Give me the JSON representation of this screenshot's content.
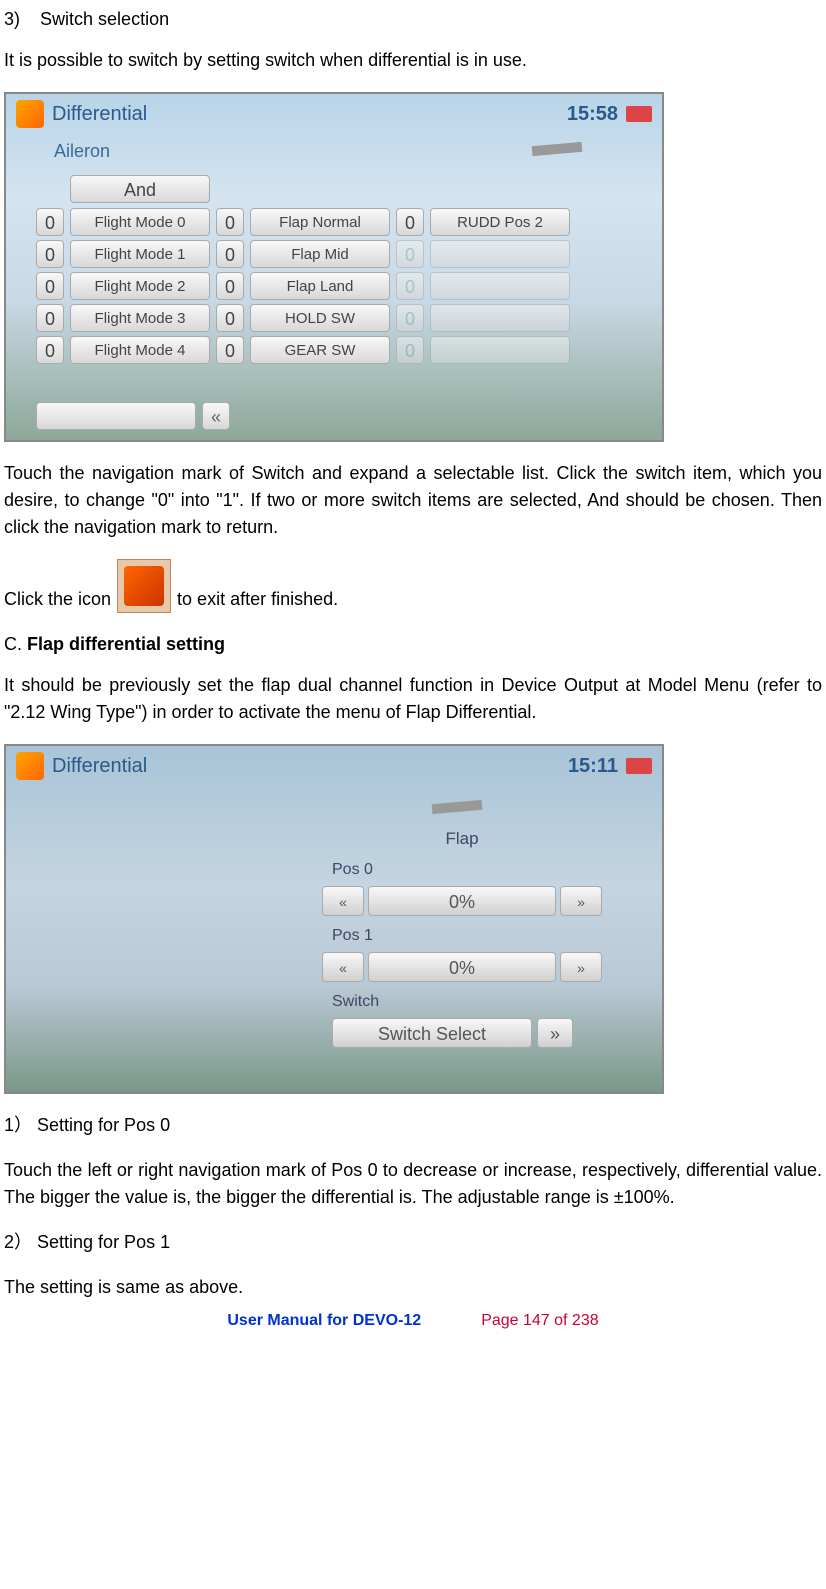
{
  "section3": {
    "num": "3)",
    "title": "Switch selection",
    "intro": "It is possible to switch by setting switch when differential is in use."
  },
  "screenshot1": {
    "title": "Differential",
    "subtitle": "Aileron",
    "clock": "15:58",
    "and_label": "And",
    "rows": [
      [
        {
          "n": "0",
          "l": "Flight Mode 0"
        },
        {
          "n": "0",
          "l": "Flap Normal"
        },
        {
          "n": "0",
          "l": "RUDD Pos 2"
        }
      ],
      [
        {
          "n": "0",
          "l": "Flight Mode 1"
        },
        {
          "n": "0",
          "l": "Flap Mid"
        },
        {
          "n": "0",
          "l": ""
        }
      ],
      [
        {
          "n": "0",
          "l": "Flight Mode 2"
        },
        {
          "n": "0",
          "l": "Flap Land"
        },
        {
          "n": "0",
          "l": ""
        }
      ],
      [
        {
          "n": "0",
          "l": "Flight Mode 3"
        },
        {
          "n": "0",
          "l": "HOLD SW"
        },
        {
          "n": "0",
          "l": ""
        }
      ],
      [
        {
          "n": "0",
          "l": "Flight Mode 4"
        },
        {
          "n": "0",
          "l": "GEAR SW"
        },
        {
          "n": "0",
          "l": ""
        }
      ]
    ],
    "arrow": "«"
  },
  "para_touch": "Touch the navigation mark of Switch and expand a selectable list. Click the switch item, which you desire, to change \"0\" into \"1\". If two or more switch items are selected, And should be chosen. Then click the navigation mark to return.",
  "click_icon_before": "Click the icon",
  "click_icon_after": "to exit after finished.",
  "sectionC": {
    "prefix": "C. ",
    "title": "Flap differential setting",
    "intro": "It should be previously set the flap dual channel function in Device Output at Model Menu (refer to \"2.12 Wing Type\") in order to activate the menu of Flap Differential."
  },
  "screenshot2": {
    "title": "Differential",
    "clock": "15:11",
    "flap_label": "Flap",
    "pos0_label": "Pos 0",
    "pos0_val": "0%",
    "pos1_label": "Pos 1",
    "pos1_val": "0%",
    "switch_label": "Switch",
    "switch_btn": "Switch Select",
    "arr_left": "«",
    "arr_right": "»"
  },
  "item1": "1） Setting for Pos 0",
  "para_pos0": "Touch the left or right navigation mark of Pos 0 to decrease or increase, respectively, differential value. The bigger the value is, the bigger the differential is. The adjustable range is ±100%.",
  "item2": "2） Setting for Pos 1",
  "para_pos1": "The setting is same as above.",
  "footer": {
    "left": "User Manual for DEVO-12",
    "right": "Page 147 of 238"
  }
}
